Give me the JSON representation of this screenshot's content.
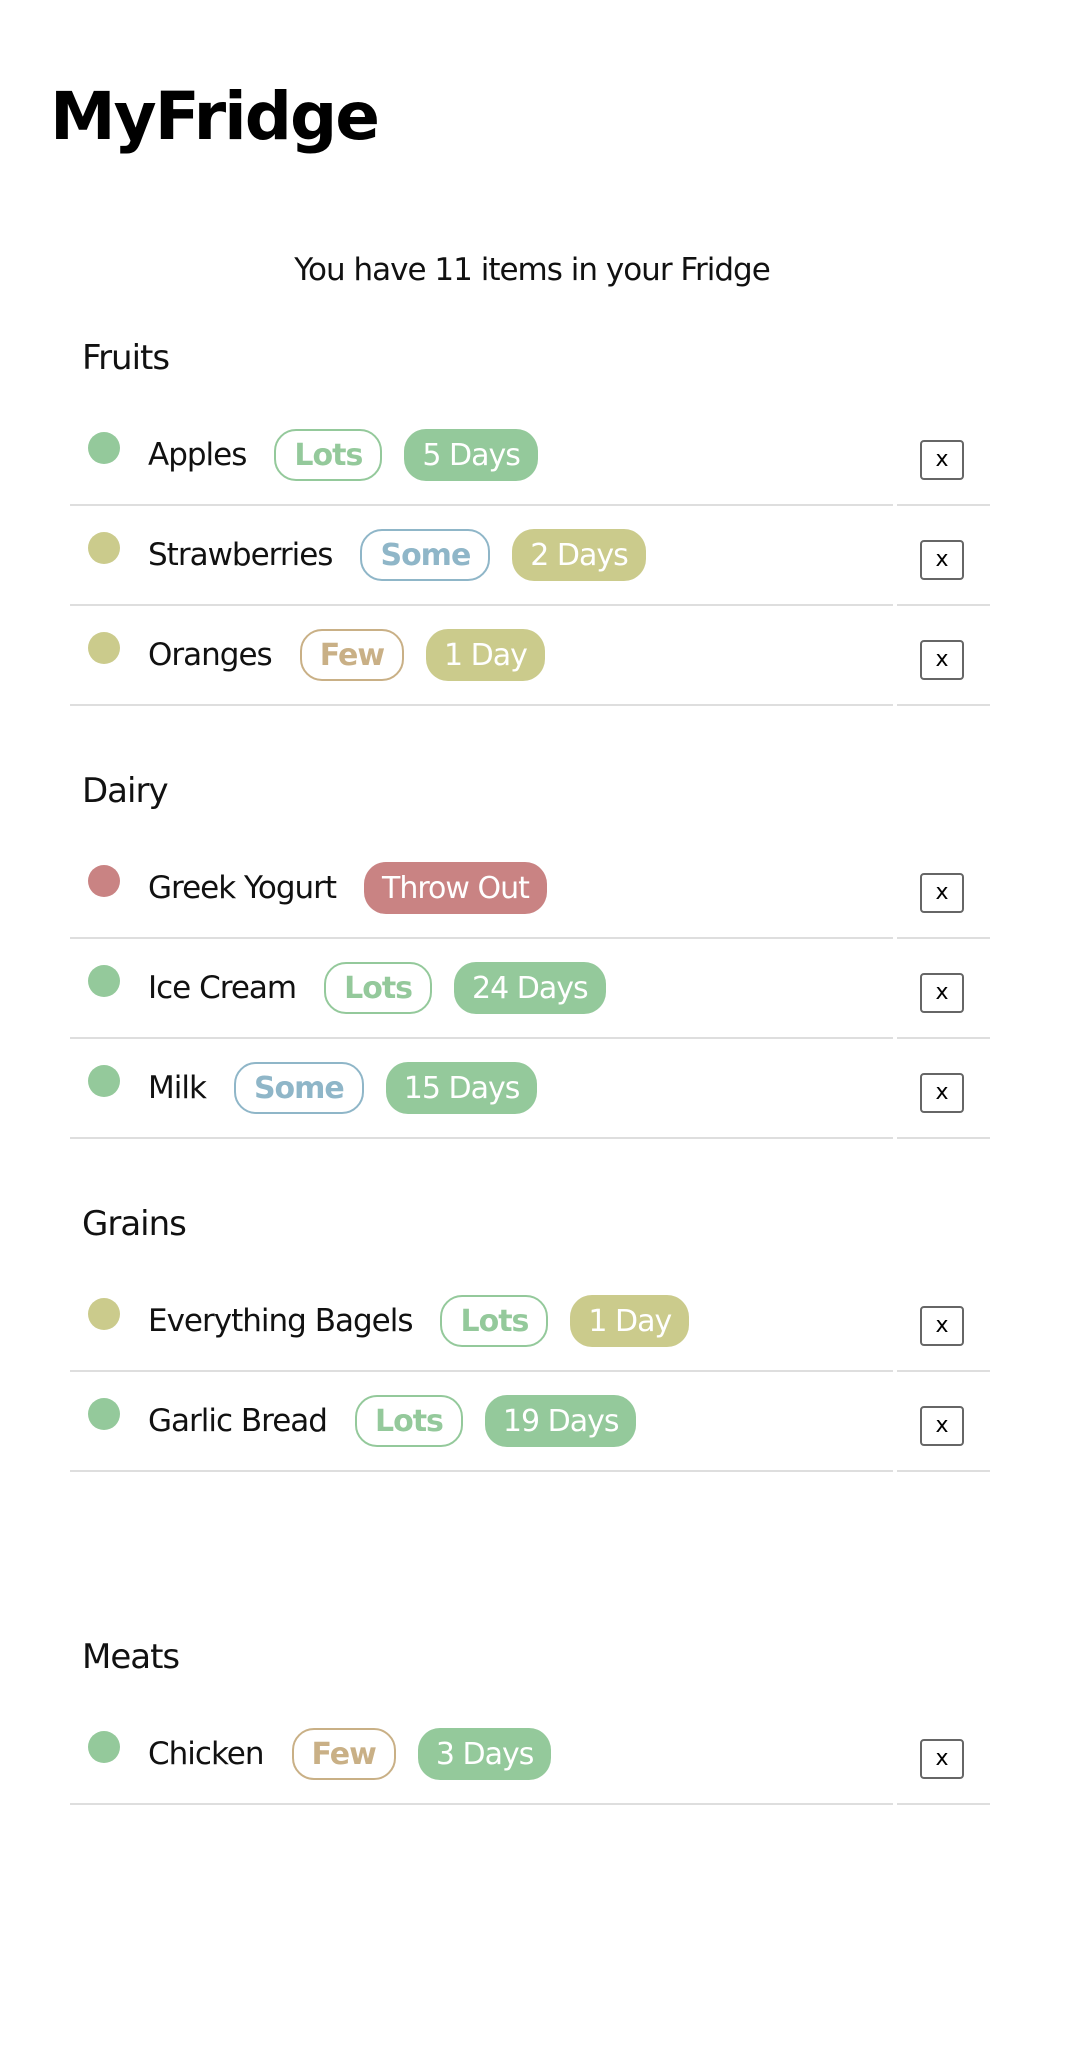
{
  "app": {
    "title": "MyFridge"
  },
  "summary": "You have 11 items in your Fridge",
  "remove_label": "x",
  "colors": {
    "fresh": "#94c99b",
    "soon": "#cbcb8c",
    "expired": "#c98383",
    "lots": "#94c99b",
    "some": "#8fb6c8",
    "few": "#c9b086"
  },
  "categories": [
    {
      "name": "Fruits",
      "items": [
        {
          "name": "Apples",
          "status": "fresh",
          "quantity": "Lots",
          "quantity_level": "lots",
          "days": "5 Days"
        },
        {
          "name": "Strawberries",
          "status": "soon",
          "quantity": "Some",
          "quantity_level": "some",
          "days": "2 Days"
        },
        {
          "name": "Oranges",
          "status": "soon",
          "quantity": "Few",
          "quantity_level": "few",
          "days": "1 Day"
        }
      ]
    },
    {
      "name": "Dairy",
      "items": [
        {
          "name": "Greek Yogurt",
          "status": "expired",
          "quantity": "",
          "quantity_level": "",
          "days": "Throw Out"
        },
        {
          "name": "Ice Cream",
          "status": "fresh",
          "quantity": "Lots",
          "quantity_level": "lots",
          "days": "24 Days"
        },
        {
          "name": "Milk",
          "status": "fresh",
          "quantity": "Some",
          "quantity_level": "some",
          "days": "15 Days"
        }
      ]
    },
    {
      "name": "Grains",
      "items": [
        {
          "name": "Everything Bagels",
          "status": "soon",
          "quantity": "Lots",
          "quantity_level": "lots",
          "days": "1 Day"
        },
        {
          "name": "Garlic Bread",
          "status": "fresh",
          "quantity": "Lots",
          "quantity_level": "lots",
          "days": "19 Days"
        }
      ]
    },
    {
      "name": "Meats",
      "items": [
        {
          "name": "Chicken",
          "status": "fresh",
          "quantity": "Few",
          "quantity_level": "few",
          "days": "3 Days"
        }
      ]
    }
  ]
}
